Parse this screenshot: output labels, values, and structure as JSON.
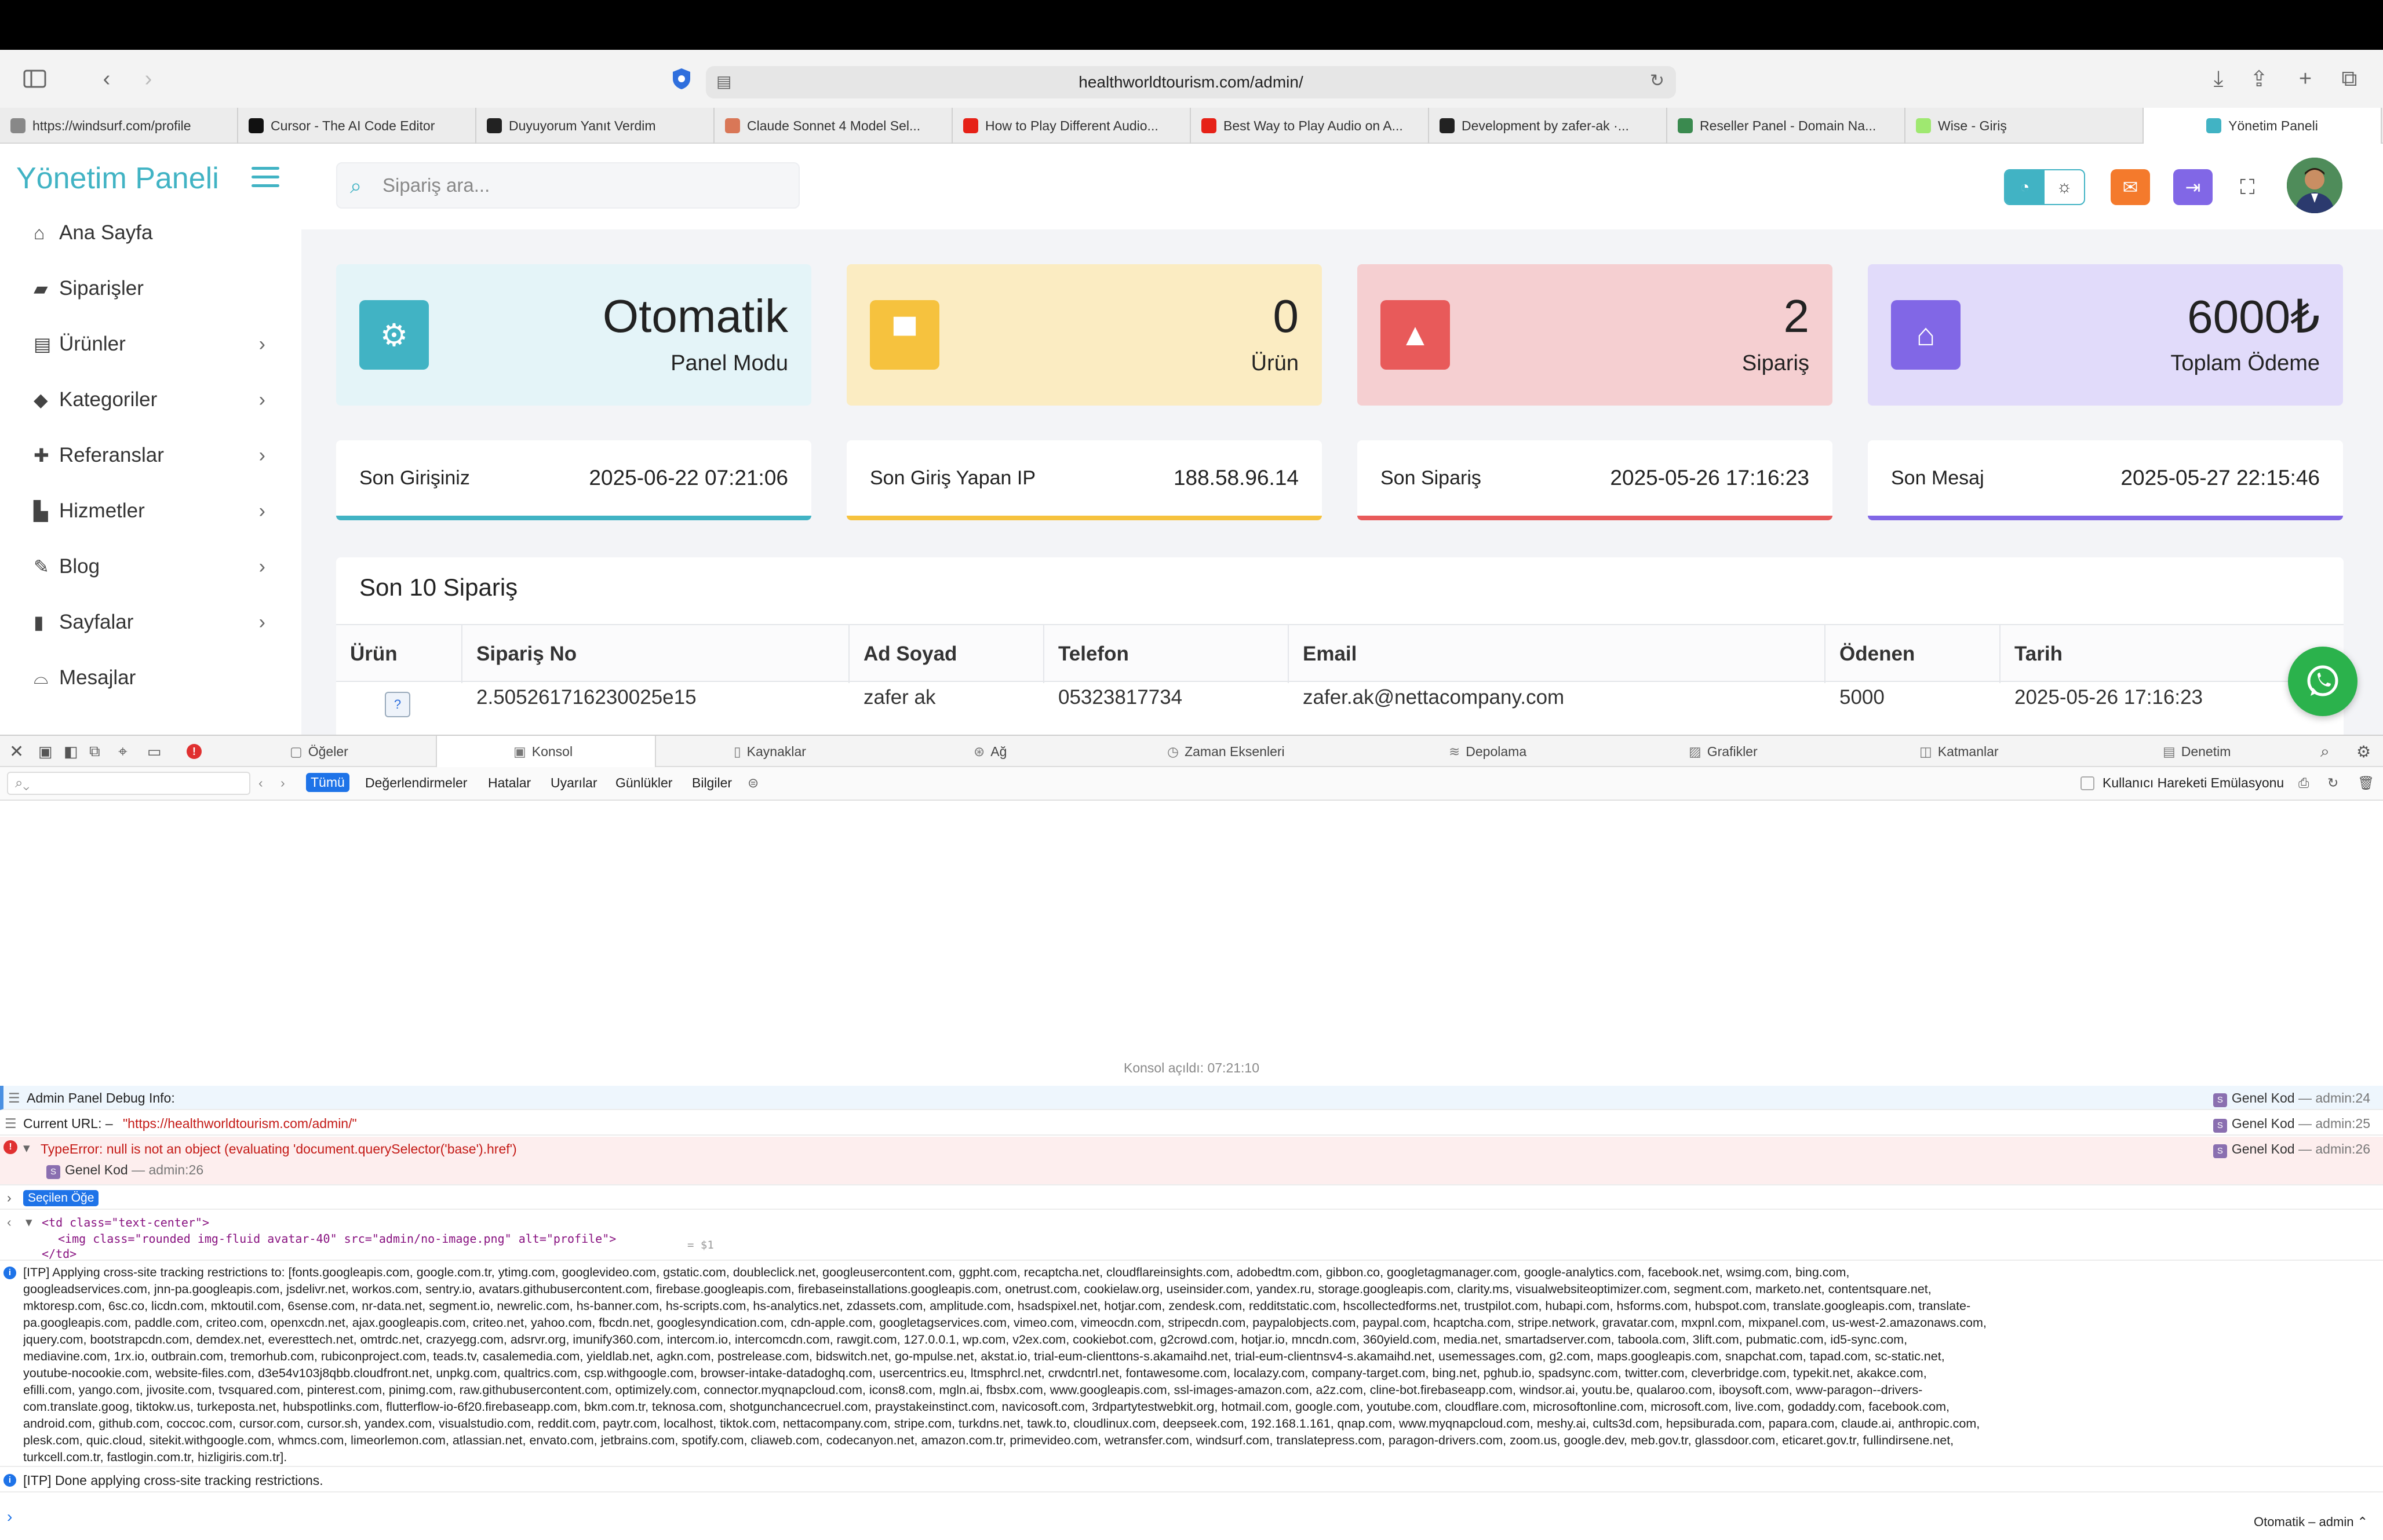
{
  "browser": {
    "url": "healthworldtourism.com/admin/",
    "tabs": [
      {
        "label": "https://windsurf.com/profile",
        "color": "#888888"
      },
      {
        "label": "Cursor - The AI Code Editor",
        "color": "#111111"
      },
      {
        "label": "Duyuyorum Yanıt Verdim",
        "color": "#222222"
      },
      {
        "label": "Claude Sonnet 4 Model Sel...",
        "color": "#d97757"
      },
      {
        "label": "How to Play Different Audio...",
        "color": "#e62117"
      },
      {
        "label": "Best Way to Play Audio on A...",
        "color": "#e62117"
      },
      {
        "label": "Development by zafer-ak ·...",
        "color": "#222222"
      },
      {
        "label": "Reseller Panel - Domain Na...",
        "color": "#3a8a4f"
      },
      {
        "label": "Wise - Giriş",
        "color": "#9fe870"
      },
      {
        "label": "Yönetim Paneli",
        "color": "#41b3c4"
      }
    ]
  },
  "sidebar": {
    "brand": "Yönetim Paneli",
    "items": [
      {
        "label": "Ana Sayfa",
        "icon": "home-icon",
        "chevron": false
      },
      {
        "label": "Siparişler",
        "icon": "bag-icon",
        "chevron": false
      },
      {
        "label": "Ürünler",
        "icon": "store-icon",
        "chevron": true
      },
      {
        "label": "Kategoriler",
        "icon": "tag-icon",
        "chevron": true
      },
      {
        "label": "Referanslar",
        "icon": "user-plus-icon",
        "chevron": true
      },
      {
        "label": "Hizmetler",
        "icon": "chart-icon",
        "chevron": true
      },
      {
        "label": "Blog",
        "icon": "blog-icon",
        "chevron": true
      },
      {
        "label": "Sayfalar",
        "icon": "file-icon",
        "chevron": true
      },
      {
        "label": "Mesajlar",
        "icon": "inbox-icon",
        "chevron": false
      }
    ]
  },
  "header": {
    "search_placeholder": "Sipariş ara..."
  },
  "stats": [
    {
      "value": "Otomatik",
      "label": "Panel Modu",
      "bg": "#e4f4f8",
      "accent": "#41b3c4",
      "icon": "gears-icon"
    },
    {
      "value": "0",
      "label": "Ürün",
      "bg": "#fbecc2",
      "accent": "#f6c23e",
      "icon": "box-icon"
    },
    {
      "value": "2",
      "label": "Sipariş",
      "bg": "#f5cfd1",
      "accent": "#e85a5a",
      "icon": "shopping-bag-icon"
    },
    {
      "value": "6000₺",
      "label": "Toplam Ödeme",
      "bg": "#e1dbfa",
      "accent": "#8167e6",
      "icon": "bank-icon"
    }
  ],
  "info": [
    {
      "label": "Son Girişiniz",
      "value": "2025-06-22 07:21:06",
      "color": "#41b3c4"
    },
    {
      "label": "Son Giriş Yapan IP",
      "value": "188.58.96.14",
      "color": "#f6c23e"
    },
    {
      "label": "Son Sipariş",
      "value": "2025-05-26 17:16:23",
      "color": "#e85a5a"
    },
    {
      "label": "Son Mesaj",
      "value": "2025-05-27 22:15:46",
      "color": "#8167e6"
    }
  ],
  "orders": {
    "title": "Son 10 Sipariş",
    "columns": [
      "Ürün",
      "Sipariş No",
      "Ad Soyad",
      "Telefon",
      "Email",
      "Ödenen",
      "Tarih"
    ],
    "rows": [
      {
        "order_no": "2.505261716230025e15",
        "name": "zafer ak",
        "phone": "05323817734",
        "email": "zafer.ak@nettacompany.com",
        "paid": "5000",
        "date": "2025-05-26 17:16:23"
      }
    ]
  },
  "devtools": {
    "tabs": [
      "Öğeler",
      "Konsol",
      "Kaynaklar",
      "Ağ",
      "Zaman Eksenleri",
      "Depolama",
      "Grafikler",
      "Katmanlar",
      "Denetim"
    ],
    "filters": [
      "Tümü",
      "Değerlendirmeler",
      "Hatalar",
      "Uyarılar",
      "Günlükler",
      "Bilgiler"
    ],
    "emulation": "Kullanıcı Hareketi Emülasyonu",
    "console_opened": "Konsol açıldı: 07:21:10",
    "messages": {
      "debug": "Admin Panel Debug Info:",
      "url_label": "Current URL: –",
      "url_value": "\"https://healthworldtourism.com/admin/\"",
      "error": "TypeError: null is not an object (evaluating 'document.querySelector('base').href')",
      "selected": "Seçilen Öğe",
      "code1": "<td class=\"text-center\">",
      "code2": "<img class=\"rounded img-fluid avatar-40\" src=\"admin/no-image.png\" alt=\"profile\">",
      "code3": "</td>",
      "dollar": "= $1",
      "itp_done": "[ITP] Done applying cross-site tracking restrictions.",
      "itp_lines": [
        "[ITP] Applying cross-site tracking restrictions to: [fonts.googleapis.com, google.com.tr, ytimg.com, googlevideo.com, gstatic.com, doubleclick.net, googleusercontent.com, ggpht.com, recaptcha.net, cloudflareinsights.com, adobedtm.com, gibbon.co, googletagmanager.com, google-analytics.com, facebook.net, wsimg.com, bing.com,",
        "googleadservices.com, jnn-pa.googleapis.com, jsdelivr.net, workos.com, sentry.io, avatars.githubusercontent.com, firebase.googleapis.com, firebaseinstallations.googleapis.com, onetrust.com, cookielaw.org, useinsider.com, yandex.ru, storage.googleapis.com, clarity.ms, visualwebsiteoptimizer.com, segment.com, marketo.net, contentsquare.net,",
        "mktoresp.com, 6sc.co, licdn.com, mktoutil.com, 6sense.com, nr-data.net, segment.io, newrelic.com, hs-banner.com, hs-scripts.com, hs-analytics.net, zdassets.com, amplitude.com, hsadspixel.net, hotjar.com, zendesk.com, redditstatic.com, hscollectedforms.net, trustpilot.com, hubapi.com, hsforms.com, hubspot.com, translate.googleapis.com, translate-",
        "pa.googleapis.com, paddle.com, criteo.com, openxcdn.net, ajax.googleapis.com, criteo.net, yahoo.com, fbcdn.net, googlesyndication.com, cdn-apple.com, googletagservices.com, vimeo.com, vimeocdn.com, stripecdn.com, paypalobjects.com, paypal.com, hcaptcha.com, stripe.network, gravatar.com, mxpnl.com, mixpanel.com, us-west-2.amazonaws.com,",
        "jquery.com, bootstrapcdn.com, demdex.net, everesttech.net, omtrdc.net, crazyegg.com, adsrvr.org, imunify360.com, intercom.io, intercomcdn.com, rawgit.com, 127.0.0.1, wp.com, v2ex.com, cookiebot.com, g2crowd.com, hotjar.io, mncdn.com, 360yield.com, media.net, smartadserver.com, taboola.com, 3lift.com, pubmatic.com, id5-sync.com,",
        "mediavine.com, 1rx.io, outbrain.com, tremorhub.com, rubiconproject.com, teads.tv, casalemedia.com, yieldlab.net, agkn.com, postrelease.com, bidswitch.net, go-mpulse.net, akstat.io, trial-eum-clienttons-s.akamaihd.net, trial-eum-clientnsv4-s.akamaihd.net, usemessages.com, g2.com, maps.googleapis.com, snapchat.com, tapad.com, sc-static.net,",
        "youtube-nocookie.com, website-files.com, d3e54v103j8qbb.cloudfront.net, unpkg.com, qualtrics.com, csp.withgoogle.com, browser-intake-datadoghq.com, usercentrics.eu, ltmsphrcl.net, crwdcntrl.net, fontawesome.com, localazy.com, company-target.com, bing.net, pghub.io, spadsync.com, twitter.com, cleverbridge.com, typekit.net, akakce.com,",
        "efilli.com, yango.com, jivosite.com, tvsquared.com, pinterest.com, pinimg.com, raw.githubusercontent.com, optimizely.com, connector.myqnapcloud.com, icons8.com, mgln.ai, fbsbx.com, www.googleapis.com, ssl-images-amazon.com, a2z.com, cline-bot.firebaseapp.com, windsor.ai, youtu.be, qualaroo.com, iboysoft.com, www-paragon--drivers-",
        "com.translate.goog, tiktokw.us, turkeposta.net, hubspotlinks.com, flutterflow-io-6f20.firebaseapp.com, bkm.com.tr, teknosa.com, shotgunchancecruel.com, praystakeinstinct.com, navicosoft.com, 3rdpartytestwebkit.org, hotmail.com, google.com, youtube.com, cloudflare.com, microsoftonline.com, microsoft.com, live.com, godaddy.com, facebook.com,",
        "android.com, github.com, coccoc.com, cursor.com, cursor.sh, yandex.com, visualstudio.com, reddit.com, paytr.com, localhost, tiktok.com, nettacompany.com, stripe.com, turkdns.net, tawk.to, cloudlinux.com, deepseek.com, 192.168.1.161, qnap.com, www.myqnapcloud.com, meshy.ai, cults3d.com, hepsiburada.com, papara.com, claude.ai, anthropic.com,",
        "plesk.com, quic.cloud, sitekit.withgoogle.com, whmcs.com, limeorlemon.com, atlassian.net, envato.com, jetbrains.com, spotify.com, cliaweb.com, codecanyon.net, amazon.com.tr, primevideo.com, wetransfer.com, windsurf.com, translatepress.com, paragon-drivers.com, zoom.us, google.dev, meb.gov.tr, glassdoor.com, eticaret.gov.tr, fullindirsene.net,",
        "turkcell.com.tr, fastlogin.com.tr, hizligiris.com.tr]."
      ],
      "source_name": "Genel Kod",
      "source_sep": "— admin:",
      "line24": "24",
      "line25": "25",
      "line26": "26",
      "context": "Otomatik – admin ⌃"
    }
  }
}
